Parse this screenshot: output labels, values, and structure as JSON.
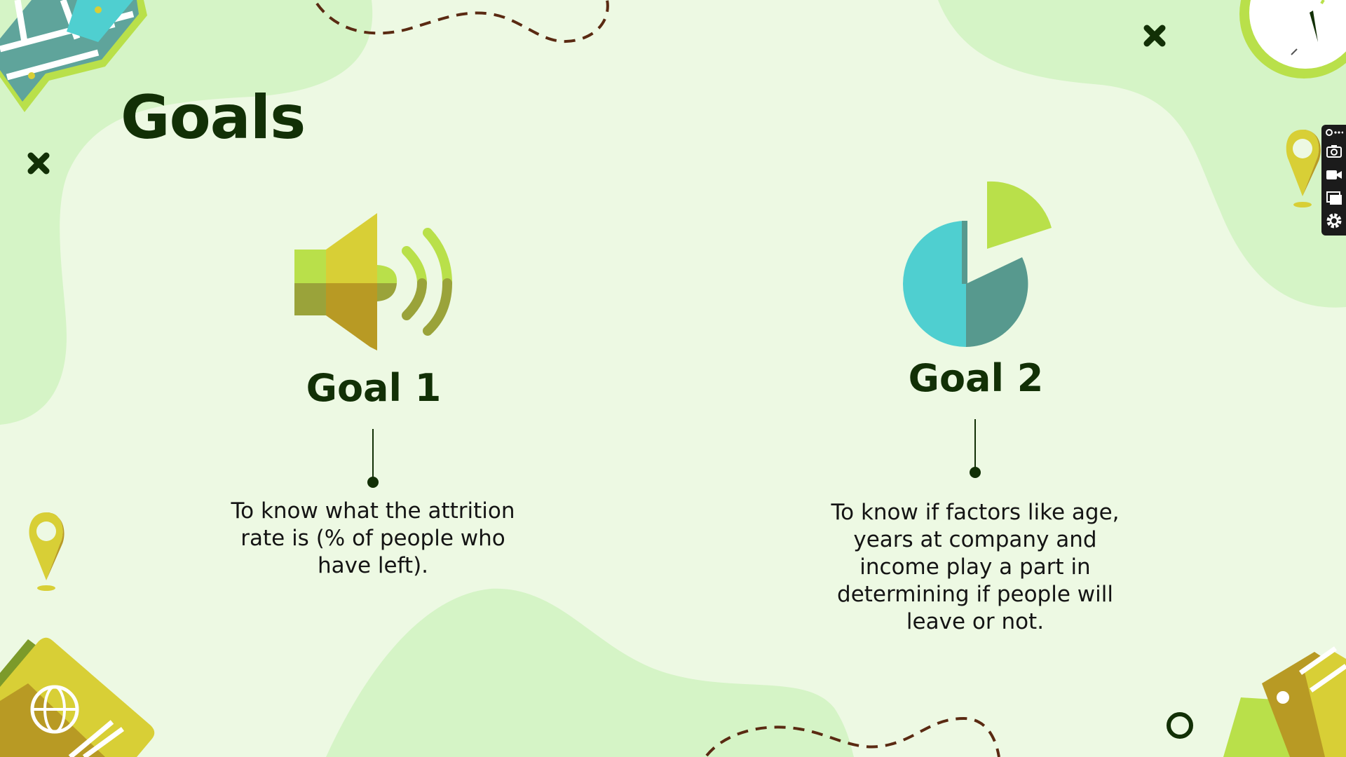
{
  "slide": {
    "title": "Goals",
    "goals": [
      {
        "title": "Goal 1",
        "icon": "speaker-icon",
        "description": "To know what the attrition rate is (% of people who have left)."
      },
      {
        "title": "Goal 2",
        "icon": "pie-chart-icon",
        "description": "To know if factors like age, years at company and income play a part in determining if people will leave or not."
      }
    ]
  },
  "toolbar": {
    "items": [
      "link-icon",
      "camera-icon",
      "video-icon",
      "screen-icon",
      "settings-icon"
    ]
  },
  "colors": {
    "background": "#edf9e3",
    "blob": "#d5f4c6",
    "dark_green": "#123006",
    "lime": "#b9e04a",
    "yellow": "#d8cf36",
    "mustard": "#b89a24",
    "teal": "#4fcfd0",
    "dark_teal": "#57998e",
    "dash_brown": "#5a2a12"
  }
}
